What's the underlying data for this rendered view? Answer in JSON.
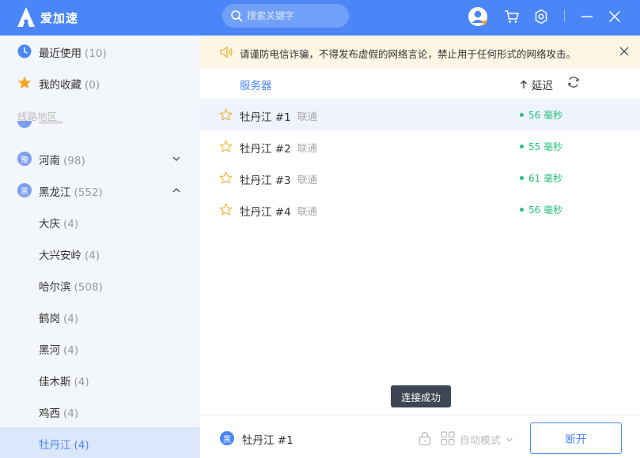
{
  "app": {
    "name": "爱加速"
  },
  "search": {
    "placeholder": "搜索关键字"
  },
  "sidebar": {
    "recent": {
      "label": "最近使用",
      "count": "(10)"
    },
    "favorites": {
      "label": "我的收藏",
      "count": "(0)"
    },
    "section_label": "线路地区",
    "regions": [
      {
        "badge": "豫",
        "label": "河南",
        "count": "(98)",
        "expanded": false
      },
      {
        "badge": "黑",
        "label": "黑龙江",
        "count": "(552)",
        "expanded": true
      }
    ],
    "cities": [
      {
        "label": "大庆",
        "count": "(4)"
      },
      {
        "label": "大兴安岭",
        "count": "(4)"
      },
      {
        "label": "哈尔滨",
        "count": "(508)"
      },
      {
        "label": "鹤岗",
        "count": "(4)"
      },
      {
        "label": "黑河",
        "count": "(4)"
      },
      {
        "label": "佳木斯",
        "count": "(4)"
      },
      {
        "label": "鸡西",
        "count": "(4)"
      },
      {
        "label": "牡丹江",
        "count": "(4)",
        "active": true
      }
    ]
  },
  "notice": {
    "text": "请谨防电信诈骗，不得发布虚假的网络言论，禁止用于任何形式的网络攻击。"
  },
  "list": {
    "header_server": "服务器",
    "header_latency": "延迟",
    "rows": [
      {
        "name": "牡丹江 #1",
        "isp": "联通",
        "latency": "56 毫秒",
        "selected": true
      },
      {
        "name": "牡丹江 #2",
        "isp": "联通",
        "latency": "55 毫秒",
        "selected": false
      },
      {
        "name": "牡丹江 #3",
        "isp": "联通",
        "latency": "61 毫秒",
        "selected": false
      },
      {
        "name": "牡丹江 #4",
        "isp": "联通",
        "latency": "56 毫秒",
        "selected": false
      }
    ]
  },
  "toast": {
    "text": "连接成功"
  },
  "bottom": {
    "current_badge": "黑",
    "current_server": "牡丹江 #1",
    "mode": "自动模式",
    "disconnect_label": "断开"
  },
  "colors": {
    "primary": "#4a86f7",
    "latency_green": "#27c17a",
    "notice_bg": "#fdf6e4",
    "sidebar_bg": "#f3f6fb"
  }
}
